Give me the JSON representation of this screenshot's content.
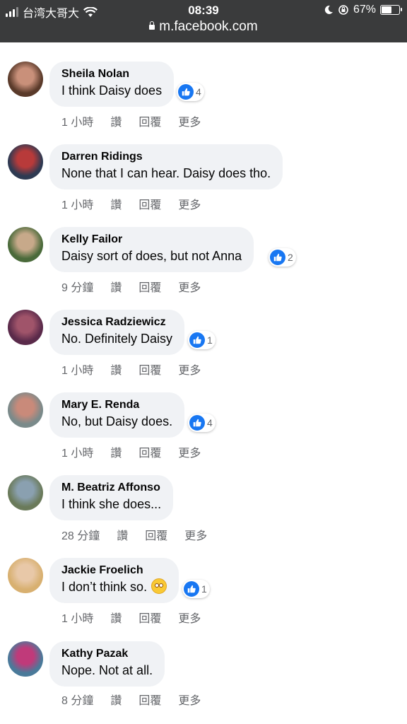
{
  "status_bar": {
    "carrier": "台湾大哥大",
    "time": "08:39",
    "battery": "67%",
    "battery_level": 0.67
  },
  "browser": {
    "url": "m.facebook.com"
  },
  "actions": {
    "like": "讚",
    "reply": "回覆",
    "more": "更多"
  },
  "comments": [
    {
      "name": "Sheila Nolan",
      "text": "I think Daisy does",
      "time": "1 小時",
      "reactions": "4",
      "avatar_colors": [
        "#5a3a2a",
        "#c9907a"
      ]
    },
    {
      "name": "Darren Ridings",
      "text": "None that I can hear. Daisy does tho.",
      "time": "1 小時",
      "reactions": "",
      "avatar_colors": [
        "#2e3a52",
        "#b83a3a"
      ]
    },
    {
      "name": "Kelly Failor",
      "text": "Daisy sort of does, but not Anna",
      "time": "9 分鐘",
      "reactions": "2",
      "avatar_colors": [
        "#4a6a3a",
        "#c7a98a"
      ]
    },
    {
      "name": "Jessica Radziewicz",
      "text": "No. Definitely Daisy",
      "time": "1 小時",
      "reactions": "1",
      "avatar_colors": [
        "#5a2a4a",
        "#a0546a"
      ]
    },
    {
      "name": "Mary E. Renda",
      "text": "No, but Daisy does.",
      "time": "1 小時",
      "reactions": "4",
      "avatar_colors": [
        "#7a8a8a",
        "#c98a7a"
      ]
    },
    {
      "name": "M. Beatriz Affonso",
      "text": "I think she does...",
      "time": "28 分鐘",
      "reactions": "",
      "avatar_colors": [
        "#6a7a5a",
        "#8aa0b0"
      ]
    },
    {
      "name": "Jackie Froelich",
      "text": "I don’t think so.",
      "emoji": "flushed-face-emoji",
      "time": "1 小時",
      "reactions": "1",
      "avatar_colors": [
        "#d8b070",
        "#e8c8a8"
      ]
    },
    {
      "name": "Kathy Pazak",
      "text": "Nope. Not at all.",
      "time": "8 分鐘",
      "reactions": "",
      "avatar_colors": [
        "#4a7a9a",
        "#c03a7a"
      ]
    }
  ],
  "colors": {
    "bubble": "#f0f2f5",
    "like_blue": "#1877f2",
    "meta_gray": "#65676b",
    "status_bg": "#3a3b3c"
  }
}
